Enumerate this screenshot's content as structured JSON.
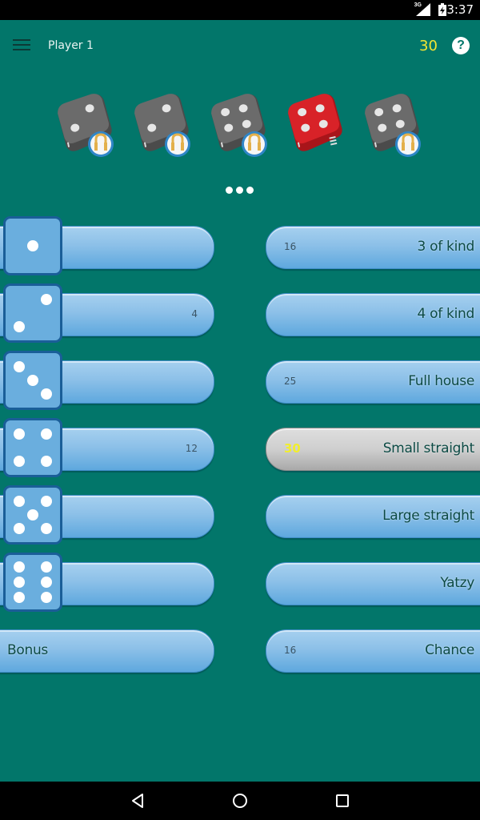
{
  "status_bar": {
    "network": "3G",
    "time": "3:37"
  },
  "app_bar": {
    "menu_icon": "hamburger-menu-icon",
    "player_name": "Player 1",
    "current_score": "30",
    "help_icon": "help-question-icon",
    "help_glyph": "?"
  },
  "dice": [
    {
      "face": 2,
      "color": "gray",
      "locked": true
    },
    {
      "face": 2,
      "color": "gray",
      "locked": true
    },
    {
      "face": 4,
      "color": "gray",
      "locked": true
    },
    {
      "face": 4,
      "color": "red",
      "locked": false
    },
    {
      "face": 4,
      "color": "gray",
      "locked": true
    }
  ],
  "colors": {
    "background": "#02766a",
    "score_yellow": "#f3e633",
    "pill_blue": "#8cc0e8",
    "die_gray": "#6b6b6b",
    "die_red": "#d82228",
    "lock_gold": "#e3b04b"
  },
  "upper_section": [
    {
      "category": "Ones",
      "die_face": 1,
      "value": ""
    },
    {
      "category": "Twos",
      "die_face": 2,
      "value": "4"
    },
    {
      "category": "Threes",
      "die_face": 3,
      "value": ""
    },
    {
      "category": "Fours",
      "die_face": 4,
      "value": "12"
    },
    {
      "category": "Fives",
      "die_face": 5,
      "value": ""
    },
    {
      "category": "Sixes",
      "die_face": 6,
      "value": ""
    },
    {
      "category": "Bonus",
      "label": "Bonus",
      "value": ""
    }
  ],
  "lower_section": [
    {
      "label": "3 of kind",
      "value": "16",
      "selected": false
    },
    {
      "label": "4 of kind",
      "value": "",
      "selected": false
    },
    {
      "label": "Full house",
      "value": "25",
      "selected": false
    },
    {
      "label": "Small straight",
      "value": "30",
      "selected": true
    },
    {
      "label": "Large straight",
      "value": "",
      "selected": false
    },
    {
      "label": "Yatzy",
      "value": "",
      "selected": false
    },
    {
      "label": "Chance",
      "value": "16",
      "selected": false
    }
  ],
  "nav_bar": [
    "back",
    "home",
    "recents"
  ]
}
